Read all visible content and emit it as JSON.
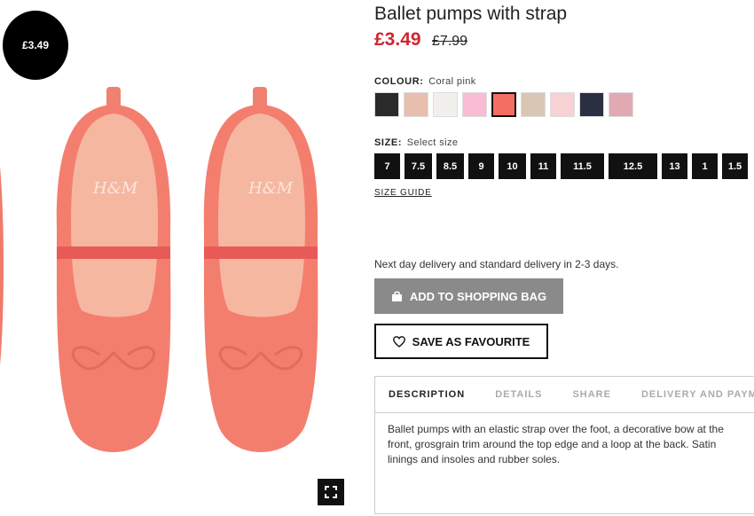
{
  "product": {
    "badge_price": "£3.49",
    "title": "Ballet pumps with strap",
    "price_current": "£3.49",
    "price_old": "£7.99",
    "brand_mark": "H&M"
  },
  "colour": {
    "label": "COLOUR:",
    "selected": "Coral pink",
    "swatches": [
      {
        "name": "black",
        "hex": "#2a2a2a"
      },
      {
        "name": "beige-pink",
        "hex": "#e8bfae"
      },
      {
        "name": "white",
        "hex": "#f1f0ec"
      },
      {
        "name": "light-pink",
        "hex": "#f8bcd4"
      },
      {
        "name": "coral-pink",
        "hex": "#f46f61"
      },
      {
        "name": "light-beige",
        "hex": "#d9c6b4"
      },
      {
        "name": "pale-pink",
        "hex": "#f7d1d3"
      },
      {
        "name": "dark-blue",
        "hex": "#2a2f42"
      },
      {
        "name": "dusty-pink",
        "hex": "#e3a9b2"
      }
    ]
  },
  "size": {
    "label": "SIZE:",
    "selected": "Select size",
    "options": [
      "7",
      "7.5",
      "8.5",
      "9",
      "10",
      "11",
      "11.5",
      "12.5",
      "13",
      "1",
      "1.5"
    ],
    "guide_label": "SIZE GUIDE"
  },
  "delivery_text": "Next day delivery and standard delivery in 2-3 days.",
  "buttons": {
    "add_to_bag": "ADD TO SHOPPING BAG",
    "favourite": "SAVE AS FAVOURITE"
  },
  "tabs": [
    {
      "label": "DESCRIPTION",
      "active": true
    },
    {
      "label": "DETAILS",
      "active": false
    },
    {
      "label": "SHARE",
      "active": false
    },
    {
      "label": "DELIVERY AND PAYME",
      "active": false
    }
  ],
  "description": "Ballet pumps with an elastic strap over the foot, a decorative bow at the front, grosgrain trim around the top edge and a loop at the back. Satin linings and insoles and rubber soles.",
  "icons": {
    "expand": "expand-icon",
    "bag": "shopping-bag-icon",
    "heart": "heart-icon"
  }
}
